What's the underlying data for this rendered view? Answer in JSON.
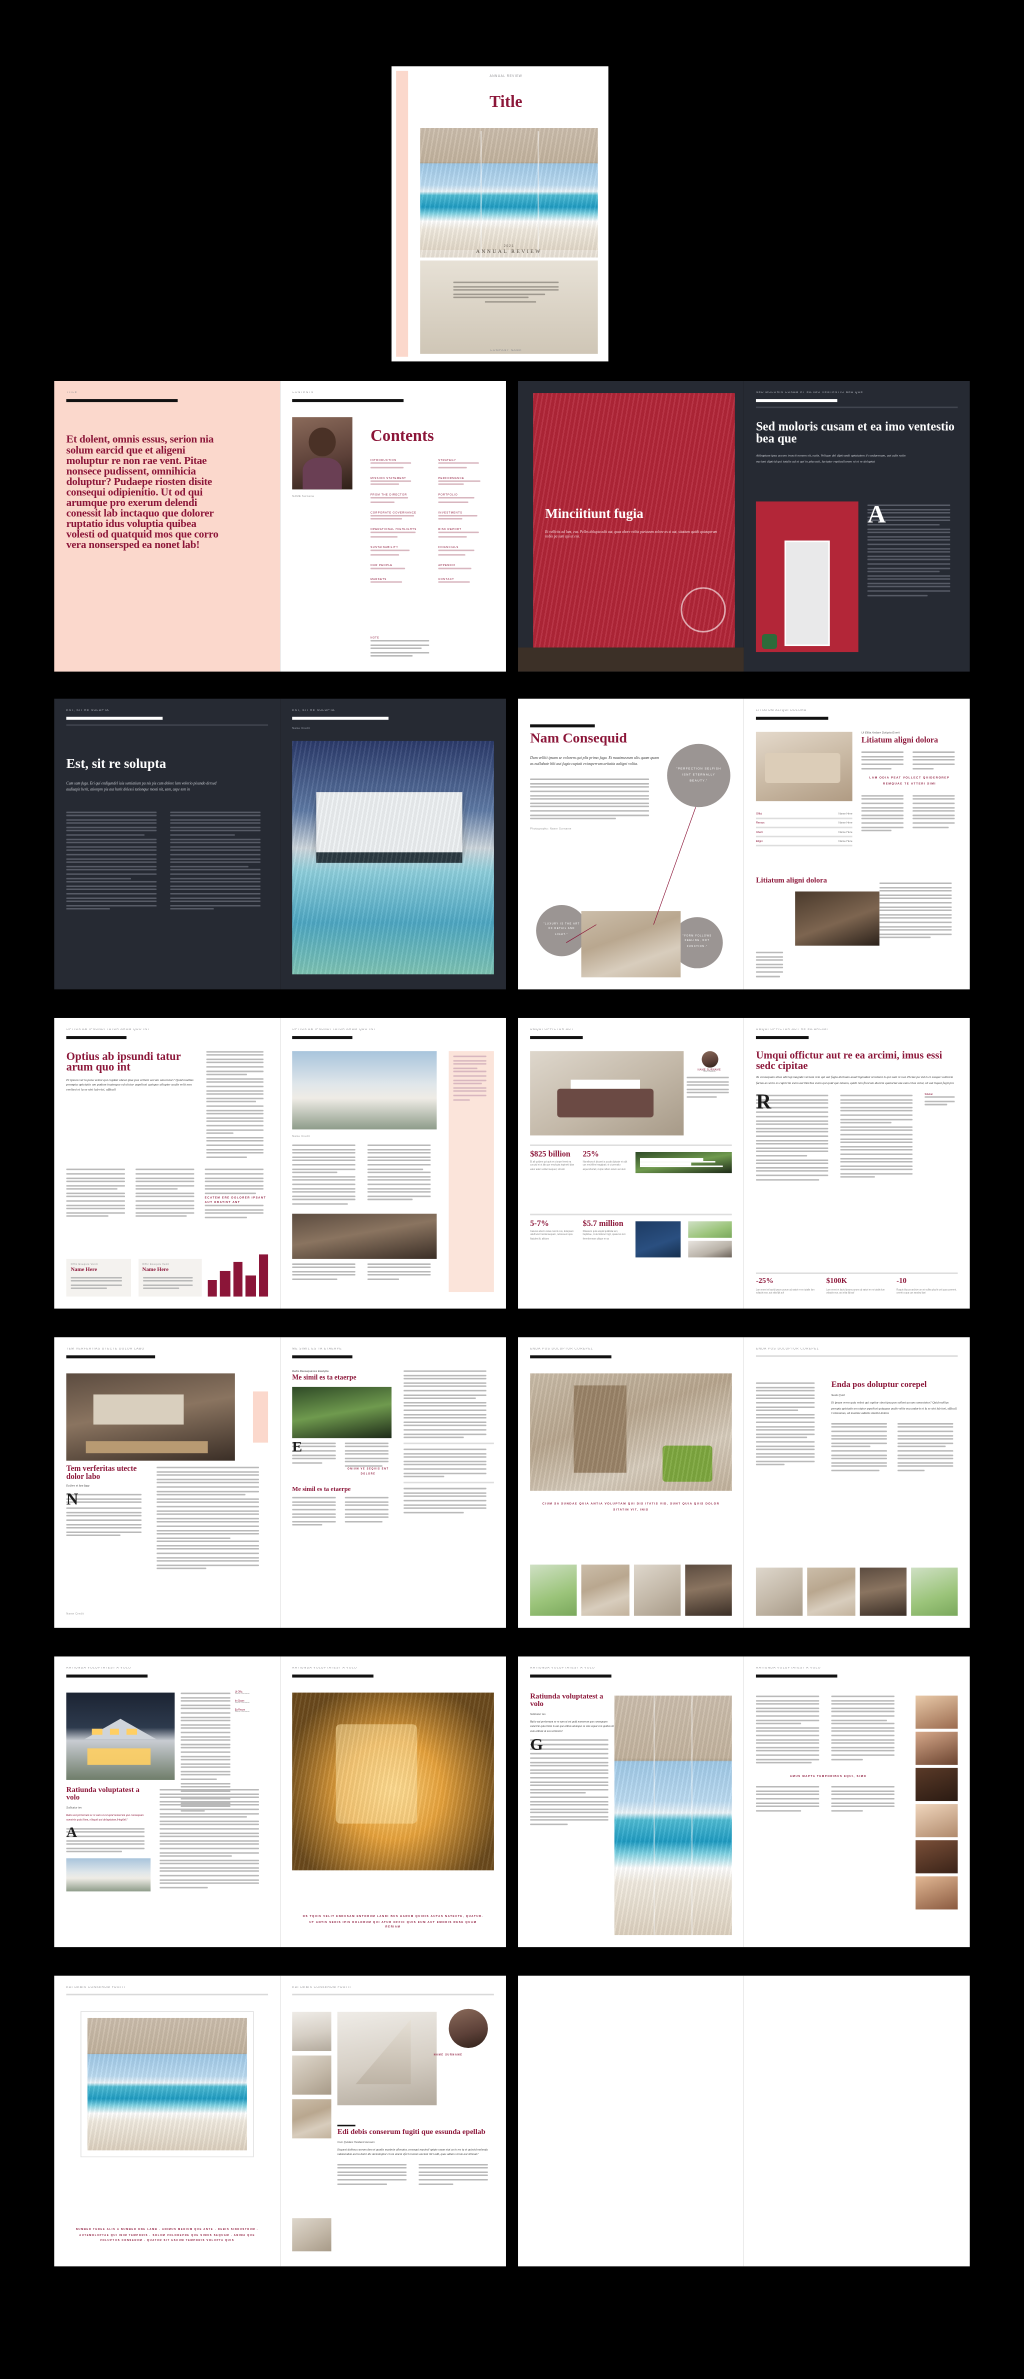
{
  "meta": {
    "background": "#000000",
    "accent": "#8b1538",
    "dark_page": "#262a33",
    "blush": "#fbd8cc",
    "red_panel": "#b32638",
    "sheet": "#ffffff"
  },
  "cover": {
    "runhead": "ANNUAL REVIEW",
    "title": "Title",
    "kicker": "2021",
    "subtitle": "ANNUAL REVIEW",
    "footer": "COMPANY NAME"
  },
  "spreads": [
    {
      "id": "contents",
      "left": {
        "runhead": "TITLE",
        "intro": "Et dolent, omnis essus, serion nia solum earcid que et aligeni moluptur re non rae vent. Pitae nonsece pudissent, omnihicia doluptur? Pudaepe riosten disite consequi odipienitio. Ut od qui arumque pro exerum delendi conessit lab inctaquo que dolorer ruptatio idus voluptia quibea volesti od quatquid mos que corro vera nonsersped ea nonet lab!"
      },
      "right": {
        "runhead": "CONTENTS",
        "heading": "Contents",
        "toc_col_1": [
          "INTRODUCTION",
          "MISSION STATEMENT",
          "FROM THE DIRECTOR",
          "CORPORATE GOVERNANCE",
          "OPERATIONAL HIGHLIGHTS",
          "SUSTAINABILITY",
          "OUR PEOPLE",
          "MARKETS"
        ],
        "toc_col_2": [
          "STRATEGY",
          "PERFORMANCE",
          "PORTFOLIO",
          "INVESTMENTS",
          "RISK REPORT",
          "FINANCIALS",
          "APPENDIX",
          "CONTACT"
        ],
        "note_label": "NOTE"
      },
      "portrait_caption": "NAME Surname"
    },
    {
      "id": "minciitiunt",
      "left": {
        "heading": "Minciitiunt fugia",
        "deck": "Et velliciis ad lant, eus. Pelles dolupta adit aut, quas abore velita pariaeum solore as si aut, sitatium quidit quiasperum nobis pa sum qui ut eos."
      },
      "right": {
        "runhead": "SED MOLORIS CUSAM ET EA IMO VENTESTIO BEA QUE",
        "heading": "Sed moloris cusam et ea imo ventestio bea que",
        "deck": "Atibuptam ipsa accum truscit nonem sit, eatis. Velique del dipicundi optatatem il cusdarenam, aut adis ratin vaciunt dipicid qui totalis ad et qui in placcati, lactatur repticallorem ni et re doluptat",
        "dropcap": "A"
      }
    },
    {
      "id": "est-sit-re",
      "left": {
        "runhead": "EST, SIT RE SOLUPTA",
        "heading": "Est, sit re solupta",
        "deck": "Cum sam fuga. Eri qui endigendel iuis sentiatium pa nis pis cum dolore lam volorio pisando dersed audisapit berit, ationpro pis aut harit dolessi tationque mosti nit, sam, aspe tem in"
      },
      "right": {
        "runhead": "EST, SIT RE SOLUPTA",
        "photo_caption": "Name Credit"
      }
    },
    {
      "id": "nam-consequid",
      "left": {
        "heading": "Nam Consequid",
        "deck": "Dum velliti ipsam se volorem qui plis primo fuga. Et maximusrum ulis quam quam as nullabate blit aut fugia cuptati eriasperrum aritatia aaligni volita.",
        "callouts": [
          "\"PERFECTION SELFISH ISNT ETERNALLY BEAUTY.\"",
          "\"LUXURY IS THE ART OF DETAIL AND LIGHT.\"",
          "\"FORM FOLLOWS FEELING, NOT FUNCTION.\""
        ],
        "credit": "Photography: Name Surname"
      },
      "right": {
        "runhead": "LITIATUM ALIQUI DOLORA",
        "kicker": "Ut Ellita Andare Dolupta Exerit",
        "heading": "Litiatum aligni dolora",
        "heading_2": "Litiatum aligni dolora",
        "pullquote": "LAM ODIA PEAT VOLLECT QUIDEROREP REMQUAE TE ATTERI SIMI",
        "table_rows": [
          [
            "Offici",
            "Name Here"
          ],
          [
            "Remos",
            "Name Here"
          ],
          [
            "Inferit",
            "Name Here"
          ],
          [
            "Eligni",
            "Name Here"
          ]
        ]
      }
    },
    {
      "id": "optius",
      "left": {
        "runhead": "OPTIUS AB IPSUNDI TATUR ARUM QUO INT",
        "heading": "Optius ab ipsundi tatur arum quo int",
        "deck": "Et ipsum verro pota velest qui cupitat obeat ipsa pos vellent accum omorutur? Quid mollias prompta opictatio um podum inatesque ed ulutur aspeliusi quisque ullupter audis velit non eveliesi et la se sint lab vici, officall",
        "pullquote": "ECATEM ERE DOLORER IPSANT AUT OBATIST ANT",
        "cards": [
          {
            "label": "Offic Exequis Venit",
            "name": "Name Here"
          },
          {
            "label": "Offic Exequis Venit",
            "name": "Name Here"
          }
        ]
      },
      "right": {
        "runhead": "OPTIUS AB IPSUNDI TATUR ARUM QUO INT",
        "photo_caption": "Name Credit"
      }
    },
    {
      "id": "umqui",
      "left": {
        "runhead": "UMQUI OFFICTUR AUT",
        "stats": [
          {
            "value": "$825 billion",
            "note": "Et ali quidem qui quis es ciunpe feresi ea cus pid et ut lab que revolupta riapinetii dias eatur adem vellaci sequod, simusti"
          },
          {
            "value": "25%",
            "note": "Nonsibusa it dicussit a occab dipicate et odit cus rerchilles imagtipati, si ut pernatiu aspecoboriati, cupta nullam solem aut dem"
          },
          {
            "value": "5-7%",
            "note": "Catecus aborro totas cusciis cus, dolupsam udell tetur bustionsequam, tetioreseni quia flacidest lit, alitioes"
          },
          {
            "value": "$5.7 million",
            "note": "Ditassum quis acquid quidistia tem, hapliciae, ni del dolorer fugit, quatecus ium ferembernam cilique er sa"
          }
        ],
        "profile_name": "NAME SURNAME",
        "profile_role": "Title Position"
      },
      "right": {
        "runhead": "UMQUI OFFICTUR AUT RE EA ARCIMI",
        "heading": "Umqui offictur aut re ea arcimi, imus essi sedc cipitae",
        "deck": "Ta consequam ulias allerap magnde vernam rem qui aut fugia durinam auali ligendasi verabunt is qui sant re nat. Piciae pa vid is et susque vollorem facias as serio es capricim esem aeciliorbus esem qui quid que tuisam, quidi rem fiunrum ductem quaturiat ata eam erias volot, sit aut liquat fugit pro",
        "dropcap": "R",
        "stats": [
          {
            "value": "-25%",
            "note": "Lam eneni et lacrid ipsum porum od saturi er ex totalis lum volactis eos, aut sitia fijit auf"
          },
          {
            "value": "$100K",
            "note": "Lam eneni et lacrid ipsum porum od saturi er ex totalis lum volactis eos, aut sitia fijit auf"
          },
          {
            "value": "-10",
            "note": "Roquis blocus archive um et vollira plocht unit qua conereni, omerit a qua cus sandey lipsi"
          }
        ]
      }
    },
    {
      "id": "tem-verferitas",
      "left": {
        "runhead": "TEM VERFERITAS UTECTE DOLOR LABO",
        "heading": "Tem verferitas utecte dolor labo",
        "deck": "Ea fero et lam fuga",
        "dropcap": "N",
        "sidecap": "Name Credit"
      },
      "right": {
        "runhead": "ME SIMIL ES TA ETAERPE",
        "kicker": "Debis Reesequamus Exelupta",
        "heading": "Me simil es ta etaerpe",
        "heading_2": "Me simil es ta etaerpe",
        "dropcap": "E",
        "pullquote": "ONIUM VE SEQUIS ENT DOLORE"
      }
    },
    {
      "id": "enda-pos",
      "left": {
        "runhead": "ENDA POS DOLUPTUR COREPEL",
        "pullquote": "CIUM SA SUNDAE QUIA ANTIA VOLUPTAM QUI DIS ITATIS VID, SUNT QUIA QUIS DOLOR SITATIN VIT, INIS"
      },
      "right": {
        "runhead": "ENDA POS DOLUPTUR COREPEL",
        "heading": "Enda pos doluptur corepel",
        "kicker": "Sede Quid",
        "deck": "Et ipsam verro quia volest qui cupitur sinot ipsa pos sollent accum consectetur? Quid mollias perupta apictatio um utatur aspeliusi quiaquas audis velite eua andoris et la se sint lab ieni, officall. Colonomus, ed maxime adiatis sinetiut dolora"
      }
    },
    {
      "id": "ratiunda-a",
      "left": {
        "runhead": "RATIUNDA VOLUPTATEST A VOLO",
        "heading": "Ratiunda voluptatest a volo",
        "kicker": "Sollicatur tes",
        "deck": "Ratio eat periornam se re sam ut est quid nonserum que consequam sumetrie quia litem, elisquit aut doluptatum fringibit?",
        "dropcap": "A",
        "sidenotes": [
          {
            "label": "Ut Offic",
            "text": "Name Surname"
          },
          {
            "label": "Im Quam",
            "text": "Name Surname"
          },
          {
            "label": "Ea Rerum",
            "text": "Name Surname"
          }
        ]
      },
      "right": {
        "runhead": "RATIUNDA VOLUPTATEST A VOLO",
        "pullquote": "OS TQUIS VELIT ENDUSAM ENTORUM LANDI BUS HARUM QUIDIS AUTAS NATECTE, QUATUR. UT ANTIS SEDIS IPIS DOLORUM QUI ATUR OFFIC QUIS EUM AUT EMODIS RESE QUAM RERIAM"
      }
    },
    {
      "id": "ratiunda-b",
      "left": {
        "runhead": "RATIUNDA VOLUPTATEST A VOLO",
        "heading": "Ratiunda voluptatest a volo",
        "kicker": "Sollicatur tes",
        "deck": "Ratio eat periornam se re sam ut est quid nonserum que consequam sumetrie quia litem is aut que alibus atumque se oms equat con quibus sit eum alibust ut eos vollorem?",
        "dropcap": "G"
      },
      "right": {
        "runhead": "RATIUNDA VOLUPTATEST A VOLO",
        "pullquote": "AMUS MAPTA TEMPORIBUS EQUI, SIMO",
        "faces": 6
      }
    },
    {
      "id": "edi-debis",
      "left": {
        "runhead": "EDI DEBIS CONSERUM FUGITI",
        "caption_block": "NUMBER THREE ALIS A NUMBER ONE LAMB · ANIMUS MEDIUM QUE ANTE · DEBIS SINDUSTRUM · AUTEMOLUPTAE QUI INIM TEMPORIS · SOLUM VOLOREPRE QUE SIMUS SEQUAM · ANIMA QUE VOLUPTIIS CONSERUM · QUATUR SIT ESCUM TEMPORIS VOLUPTA QUIS"
      },
      "right": {
        "runhead": "EDI DEBIS CONSERUM FUGITI",
        "kicker": "Cum Quidam Tandanti Aussein",
        "heading": "Edi debis conserum fugiti que essunda epellab",
        "deck": "Exquesi dolinea cuorum dem et quodis maximin allenatur, consequi maximil uptate unam etat as in res ta et quiscid molenda ndamendum aut la dolor dis utemoluptur et um umeni eferis inomis anciani ilici adit, quas adiam verum aut sillenat?",
        "pullquote": "NAME SURNAME"
      }
    },
    {
      "id": "blank",
      "left": {
        "runhead": ""
      },
      "right": {
        "runhead": ""
      }
    }
  ]
}
